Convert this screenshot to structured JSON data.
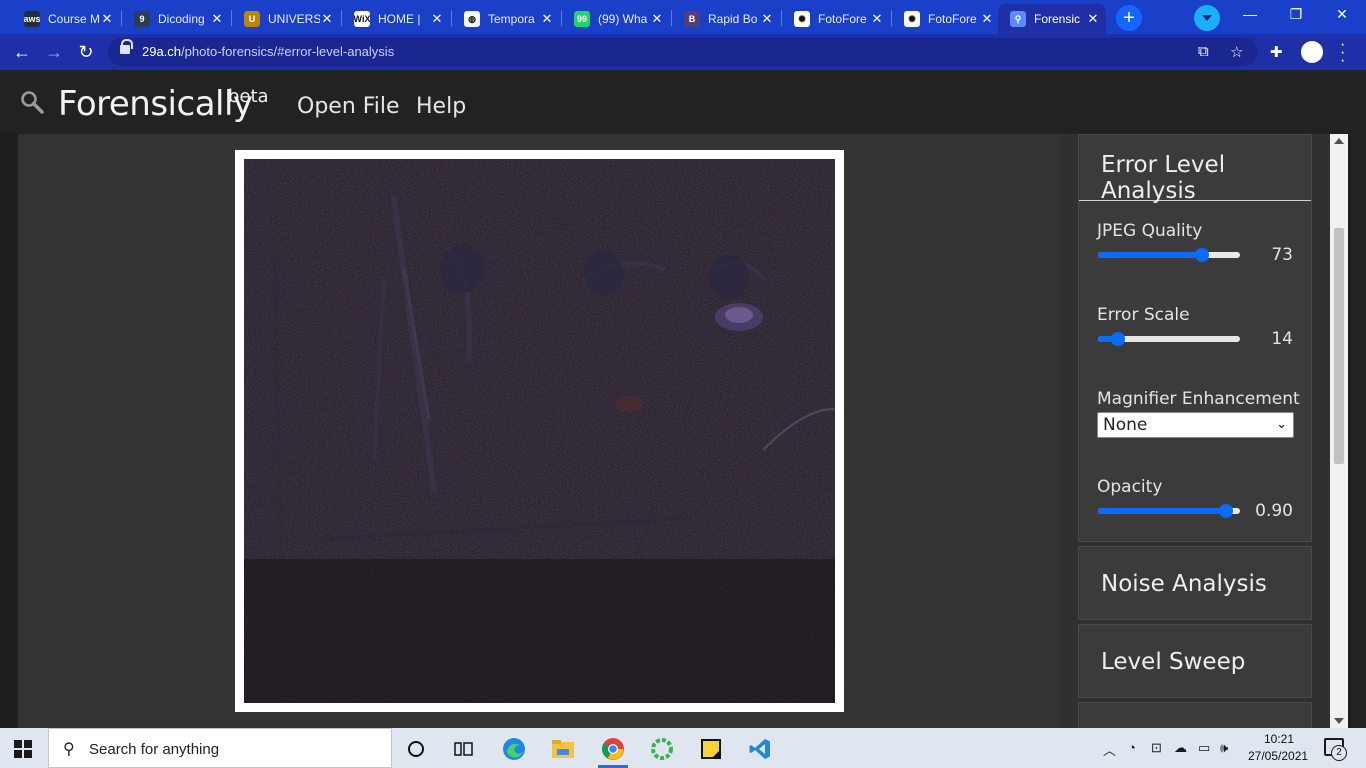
{
  "browser": {
    "tabs": [
      {
        "title": "Course M",
        "icon": "aws-icon",
        "color": "#232f3e",
        "glyph": "aws"
      },
      {
        "title": "Dicoding",
        "icon": "dicoding-icon",
        "color": "#2d3e50",
        "glyph": "9"
      },
      {
        "title": "UNIVERS",
        "icon": "university-crest-icon",
        "color": "#b8860b",
        "glyph": "U"
      },
      {
        "title": "HOME |",
        "icon": "wix-icon",
        "color": "#ffffff",
        "glyph": "WiX"
      },
      {
        "title": "Tempora",
        "icon": "globe-icon",
        "color": "#ffffff",
        "glyph": "◍"
      },
      {
        "title": "(99) Wha",
        "icon": "whatsapp-icon",
        "color": "#25d366",
        "glyph": "99"
      },
      {
        "title": "Rapid Bo",
        "icon": "bootstrap-icon",
        "color": "#563d7c",
        "glyph": "B"
      },
      {
        "title": "FotoFore",
        "icon": "fotoforensics-icon",
        "color": "#ffffff",
        "glyph": "✺"
      },
      {
        "title": "FotoFore",
        "icon": "fotoforensics-icon",
        "color": "#ffffff",
        "glyph": "✺"
      },
      {
        "title": "Forensic",
        "icon": "magnifier-icon",
        "color": "#5b8cff",
        "glyph": "⚲"
      }
    ],
    "close_glyph": "✕",
    "new_tab_glyph": "+",
    "url_host": "29a.ch",
    "url_path": "/photo-forensics/#error-level-analysis"
  },
  "site": {
    "brand": "Forensically",
    "beta": "beta",
    "menu": {
      "open_file": "Open File",
      "help": "Help"
    }
  },
  "ela": {
    "title": "Error Level Analysis",
    "jpeg_quality": {
      "label": "JPEG Quality",
      "value": "73",
      "min": 0,
      "max": 100
    },
    "error_scale": {
      "label": "Error Scale",
      "value": "14",
      "min": 0,
      "max": 100
    },
    "magnifier": {
      "label": "Magnifier Enhancement",
      "selected": "None"
    },
    "opacity": {
      "label": "Opacity",
      "value": "0.90",
      "min": 0,
      "max": 1
    }
  },
  "panels": {
    "noise": "Noise Analysis",
    "sweep": "Level Sweep"
  },
  "taskbar": {
    "search_placeholder": "Search for anything",
    "time": "10:21",
    "date": "27/05/2021",
    "notification_count": "2"
  }
}
